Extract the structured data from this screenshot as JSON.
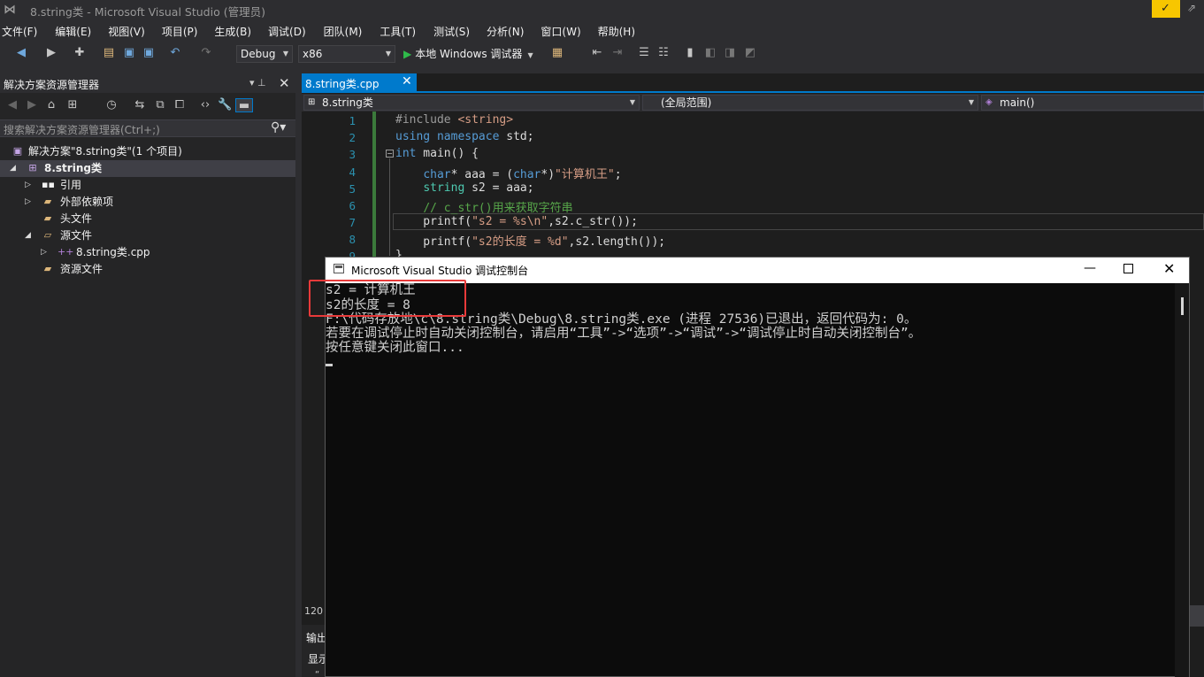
{
  "title_bar": {
    "logo": "vs-logo-icon",
    "title": "8.string类 - Microsoft Visual Studio (管理员)",
    "badge_color": "#f7c600"
  },
  "menu": [
    "文件(F)",
    "编辑(E)",
    "视图(V)",
    "项目(P)",
    "生成(B)",
    "调试(D)",
    "团队(M)",
    "工具(T)",
    "测试(S)",
    "分析(N)",
    "窗口(W)",
    "帮助(H)"
  ],
  "toolbar": {
    "config": "Debug",
    "platform": "x86",
    "run_label": "本地 Windows 调试器"
  },
  "solution_explorer": {
    "title": "解决方案资源管理器",
    "search_placeholder": "搜索解决方案资源管理器(Ctrl+;)",
    "tree": {
      "solution": "解决方案\"8.string类\"(1 个项目)",
      "project": "8.string类",
      "references": "引用",
      "external_deps": "外部依赖项",
      "headers": "头文件",
      "sources": "源文件",
      "source_file": "8.string类.cpp",
      "resources": "资源文件"
    }
  },
  "editor": {
    "tab_label": "8.string类.cpp",
    "nav_project": "8.string类",
    "nav_scope": "(全局范围)",
    "nav_member": "main()",
    "line_numbers": [
      "1",
      "2",
      "3",
      "4",
      "5",
      "6",
      "7",
      "8",
      "9"
    ],
    "zoom": "120 %",
    "accent_color": "#007acc"
  },
  "output_panel": {
    "label": "输出",
    "show_label": "显示",
    "quote": "“"
  },
  "console": {
    "title": "Microsoft Visual Studio 调试控制台",
    "lines": [
      "s2 = 计算机王",
      "s2的长度 = 8",
      "F:\\代码存放地\\c\\8.string类\\Debug\\8.string类.exe (进程 27536)已退出，返回代码为: 0。",
      "若要在调试停止时自动关闭控制台，请启用“工具”->“选项”->“调试”->“调试停止时自动关闭控制台”。",
      "按任意键关闭此窗口..."
    ],
    "highlight_color": "#e83a3a"
  }
}
